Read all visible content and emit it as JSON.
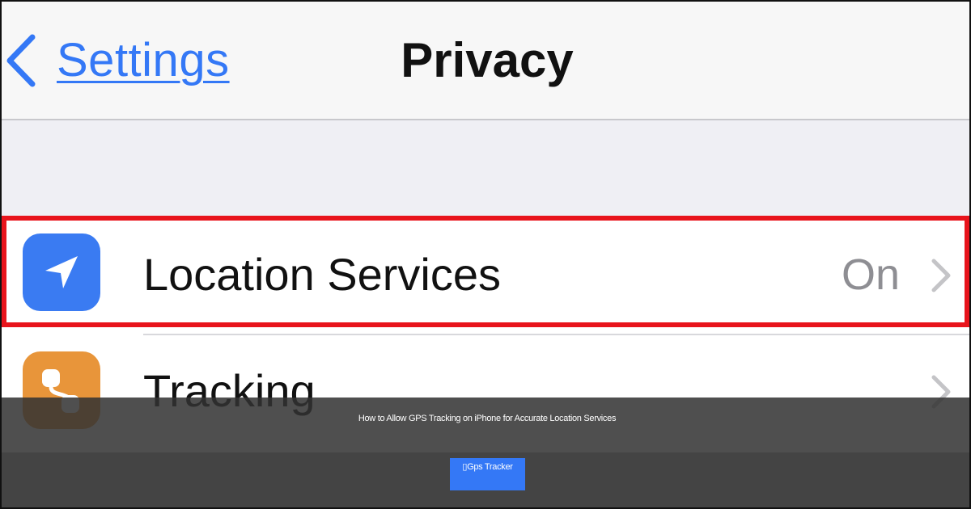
{
  "navbar": {
    "back_label": "Settings",
    "title": "Privacy"
  },
  "rows": [
    {
      "label": "Location Services",
      "value": "On",
      "icon": "location-arrow-icon",
      "icon_color": "#3a7bf2"
    },
    {
      "label": "Tracking",
      "value": "",
      "icon": "tracking-icon",
      "icon_color": "#e8953a"
    }
  ],
  "overlay": {
    "caption": "How to Allow GPS Tracking on iPhone for Accurate Location Services",
    "button_label": "▯Gps Tracker"
  },
  "colors": {
    "accent": "#3478f6",
    "highlight": "#e8141c"
  }
}
